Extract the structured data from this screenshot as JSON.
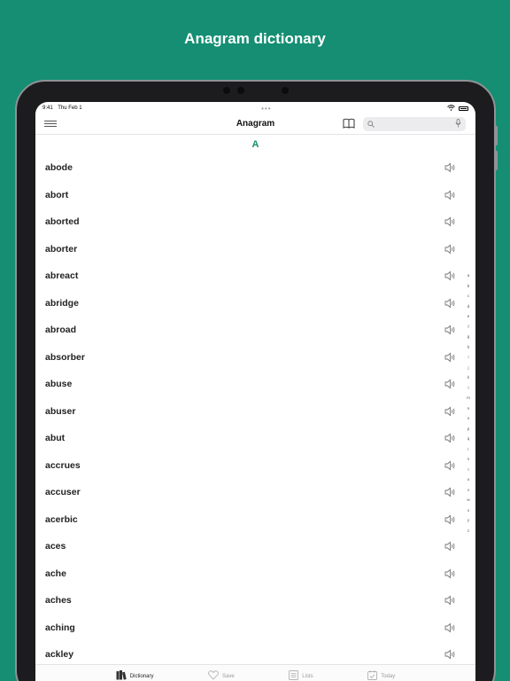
{
  "promo": {
    "title": "Anagram dictionary"
  },
  "status": {
    "time": "9:41",
    "date": "Thu Feb 1",
    "dots": "•••"
  },
  "nav": {
    "title": "Anagram",
    "search_placeholder": ""
  },
  "section": {
    "letter": "A"
  },
  "words": [
    "abode",
    "abort",
    "aborted",
    "aborter",
    "abreact",
    "abridge",
    "abroad",
    "absorber",
    "abuse",
    "abuser",
    "abut",
    "accrues",
    "accuser",
    "acerbic",
    "aces",
    "ache",
    "aches",
    "aching",
    "ackley"
  ],
  "alpha_index": [
    "a",
    "b",
    "c",
    "d",
    "e",
    "f",
    "g",
    "h",
    "i",
    "j",
    "k",
    "l",
    "m",
    "n",
    "o",
    "p",
    "q",
    "r",
    "s",
    "t",
    "u",
    "v",
    "w",
    "x",
    "y",
    "z"
  ],
  "tabs": [
    {
      "label": "Dictionary",
      "icon": "books-icon",
      "active": true
    },
    {
      "label": "Save",
      "icon": "heart-icon",
      "active": false
    },
    {
      "label": "Lists",
      "icon": "list-icon",
      "active": false
    },
    {
      "label": "Today",
      "icon": "calendar-icon",
      "active": false
    }
  ],
  "colors": {
    "accent": "#158e73",
    "background": "#158e73"
  }
}
